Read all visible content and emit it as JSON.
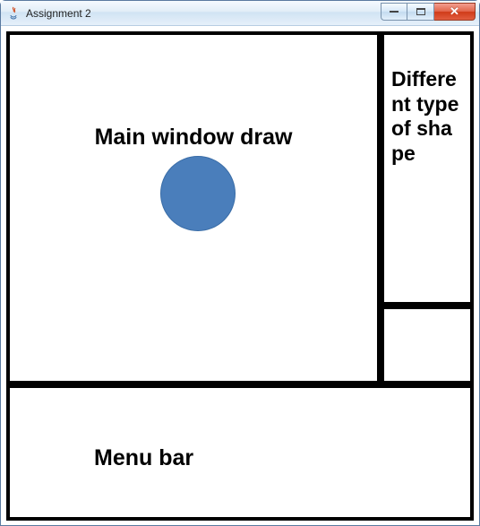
{
  "window": {
    "title": "Assignment 2"
  },
  "panels": {
    "main": {
      "label": "Main window draw",
      "shape": "circle",
      "shape_color": "#4a7ebb"
    },
    "shapes": {
      "label": "Different type of shape"
    },
    "menu": {
      "label": "Menu bar"
    }
  }
}
